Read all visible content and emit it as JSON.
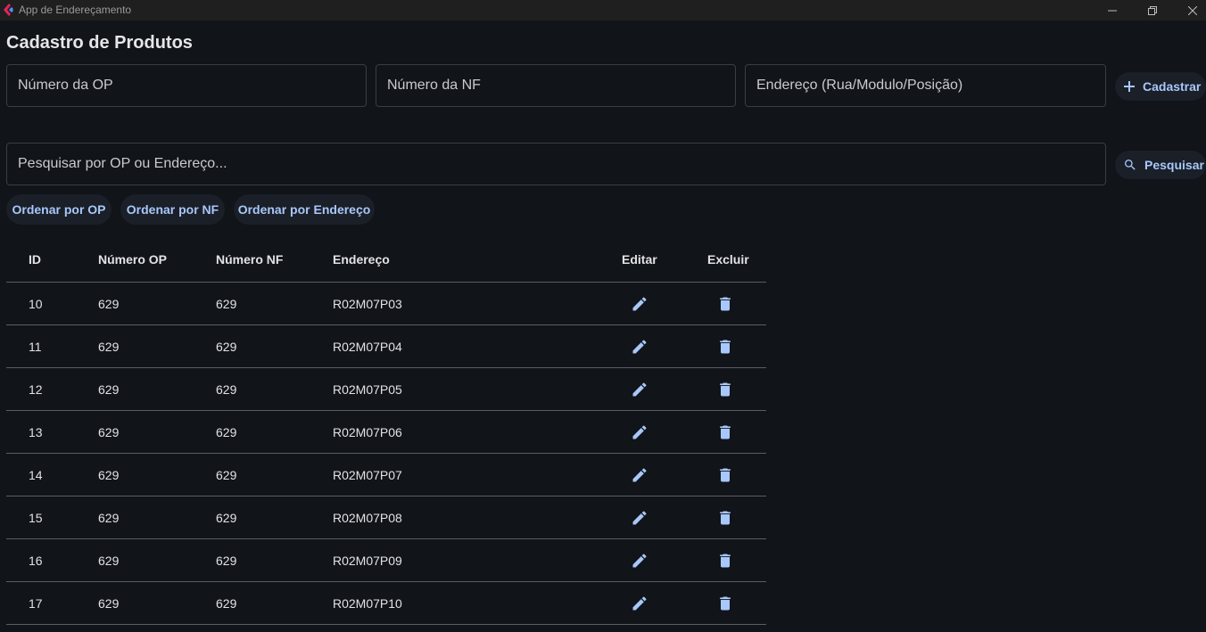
{
  "window": {
    "title": "App de Endereçamento",
    "app_icon": "app-logo-icon",
    "controls": [
      "minimize-icon",
      "restore-icon",
      "close-icon"
    ]
  },
  "page": {
    "title": "Cadastro de Produtos"
  },
  "form": {
    "op_placeholder": "Número da OP",
    "nf_placeholder": "Número da NF",
    "endereco_placeholder": "Endereço (Rua/Modulo/Posição)",
    "op_value": "",
    "nf_value": "",
    "endereco_value": "",
    "submit_label": "Cadastrar",
    "submit_icon": "plus-icon"
  },
  "search": {
    "placeholder": "Pesquisar por OP ou Endereço...",
    "value": "",
    "button_label": "Pesquisar",
    "button_icon": "search-icon"
  },
  "sort": {
    "by_op": "Ordenar por OP",
    "by_nf": "Ordenar por NF",
    "by_endereco": "Ordenar por Endereço"
  },
  "table": {
    "headers": {
      "id": "ID",
      "op": "Número OP",
      "nf": "Número NF",
      "endereco": "Endereço",
      "editar": "Editar",
      "excluir": "Excluir"
    },
    "rows": [
      {
        "id": "10",
        "op": "629",
        "nf": "629",
        "endereco": "R02M07P03"
      },
      {
        "id": "11",
        "op": "629",
        "nf": "629",
        "endereco": "R02M07P04"
      },
      {
        "id": "12",
        "op": "629",
        "nf": "629",
        "endereco": "R02M07P05"
      },
      {
        "id": "13",
        "op": "629",
        "nf": "629",
        "endereco": "R02M07P06"
      },
      {
        "id": "14",
        "op": "629",
        "nf": "629",
        "endereco": "R02M07P07"
      },
      {
        "id": "15",
        "op": "629",
        "nf": "629",
        "endereco": "R02M07P08"
      },
      {
        "id": "16",
        "op": "629",
        "nf": "629",
        "endereco": "R02M07P09"
      },
      {
        "id": "17",
        "op": "629",
        "nf": "629",
        "endereco": "R02M07P10"
      }
    ],
    "edit_icon": "pencil-icon",
    "delete_icon": "trash-icon"
  },
  "colors": {
    "background": "#111418",
    "accent": "#a8c7fa",
    "title_bar": "#1f1f1f",
    "divider": "#5a5d66"
  }
}
